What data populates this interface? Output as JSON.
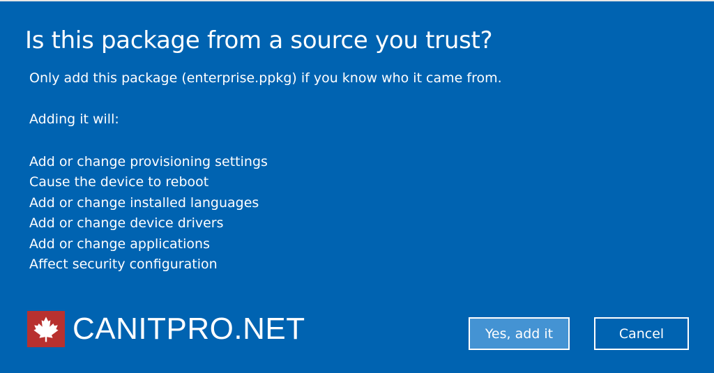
{
  "dialog": {
    "title": "Is this package from a source you trust?",
    "subtitle": "Only add this package (enterprise.ppkg) if you know who it came from.",
    "intro": "Adding it will:",
    "effects": [
      "Add or change provisioning settings",
      "Cause the device to reboot",
      "Add or change installed languages",
      "Add or change device drivers",
      "Add or change applications",
      "Affect security configuration"
    ],
    "buttons": {
      "primary_label": "Yes, add it",
      "secondary_label": "Cancel"
    }
  },
  "brand": {
    "text": "CANITPRO.NET",
    "logo_icon": "maple-leaf-icon"
  },
  "colors": {
    "dialog_background": "#0063b1",
    "primary_button": "#4493d3",
    "logo_background": "#b8312f",
    "text": "#ffffff"
  }
}
